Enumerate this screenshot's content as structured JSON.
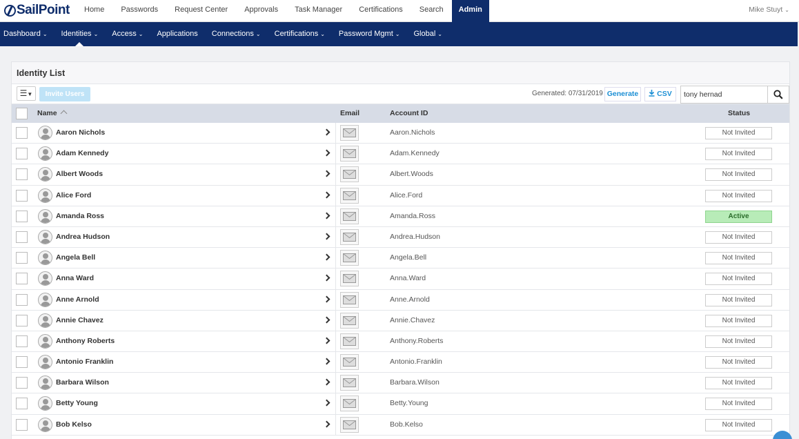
{
  "topbar": {
    "logo": "SailPoint",
    "nav": [
      "Home",
      "Passwords",
      "Request Center",
      "Approvals",
      "Task Manager",
      "Certifications",
      "Search",
      "Admin"
    ],
    "active_nav": "Admin",
    "user": "Mike Stuyt"
  },
  "subnav": {
    "items": [
      {
        "label": "Dashboard",
        "dropdown": true
      },
      {
        "label": "Identities",
        "dropdown": true
      },
      {
        "label": "Access",
        "dropdown": true
      },
      {
        "label": "Applications",
        "dropdown": false
      },
      {
        "label": "Connections",
        "dropdown": true
      },
      {
        "label": "Certifications",
        "dropdown": true
      },
      {
        "label": "Password Mgmt",
        "dropdown": true
      },
      {
        "label": "Global",
        "dropdown": true
      }
    ],
    "active": "Identities"
  },
  "panel": {
    "title": "Identity List",
    "toolbar": {
      "menu_icon": "hamburger-icon",
      "invite_label": "Invite Users",
      "generated": "Generated: 07/31/2019",
      "generate_label": "Generate",
      "csv_label": "CSV",
      "search_value": "tony hernad"
    },
    "columns": {
      "name": "Name",
      "email": "Email",
      "account_id": "Account ID",
      "status": "Status"
    },
    "rows": [
      {
        "name": "Aaron Nichols",
        "account_id": "Aaron.Nichols",
        "status": "Not Invited"
      },
      {
        "name": "Adam Kennedy",
        "account_id": "Adam.Kennedy",
        "status": "Not Invited"
      },
      {
        "name": "Albert Woods",
        "account_id": "Albert.Woods",
        "status": "Not Invited"
      },
      {
        "name": "Alice Ford",
        "account_id": "Alice.Ford",
        "status": "Not Invited"
      },
      {
        "name": "Amanda Ross",
        "account_id": "Amanda.Ross",
        "status": "Active"
      },
      {
        "name": "Andrea Hudson",
        "account_id": "Andrea.Hudson",
        "status": "Not Invited"
      },
      {
        "name": "Angela Bell",
        "account_id": "Angela.Bell",
        "status": "Not Invited"
      },
      {
        "name": "Anna Ward",
        "account_id": "Anna.Ward",
        "status": "Not Invited"
      },
      {
        "name": "Anne Arnold",
        "account_id": "Anne.Arnold",
        "status": "Not Invited"
      },
      {
        "name": "Annie Chavez",
        "account_id": "Annie.Chavez",
        "status": "Not Invited"
      },
      {
        "name": "Anthony Roberts",
        "account_id": "Anthony.Roberts",
        "status": "Not Invited"
      },
      {
        "name": "Antonio Franklin",
        "account_id": "Antonio.Franklin",
        "status": "Not Invited"
      },
      {
        "name": "Barbara Wilson",
        "account_id": "Barbara.Wilson",
        "status": "Not Invited"
      },
      {
        "name": "Betty Young",
        "account_id": "Betty.Young",
        "status": "Not Invited"
      },
      {
        "name": "Bob Kelso",
        "account_id": "Bob.Kelso",
        "status": "Not Invited"
      }
    ]
  }
}
